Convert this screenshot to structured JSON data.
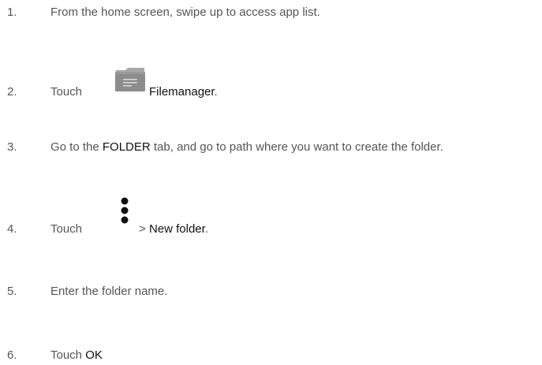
{
  "steps": [
    {
      "number": "1.",
      "text": "From the home screen, swipe up to access app list."
    },
    {
      "number": "2.",
      "before": "Touch",
      "icon": "folder-icon",
      "strong": "Filemanager",
      "after": "."
    },
    {
      "number": "3.",
      "before": "Go to the ",
      "strong": "FOLDER",
      "after": " tab, and go to path where you want to create the folder."
    },
    {
      "number": "4.",
      "before": "Touch",
      "icon": "more-options-icon",
      "middle": "> ",
      "strong": "New folder",
      "after": "."
    },
    {
      "number": "5.",
      "text": "Enter the folder name."
    },
    {
      "number": "6.",
      "before": "Touch ",
      "strong": "OK"
    }
  ],
  "colors": {
    "text": "#555555",
    "bold": "#111111",
    "folder_icon": "#8c8c8c",
    "menu_dots": "#111111"
  }
}
